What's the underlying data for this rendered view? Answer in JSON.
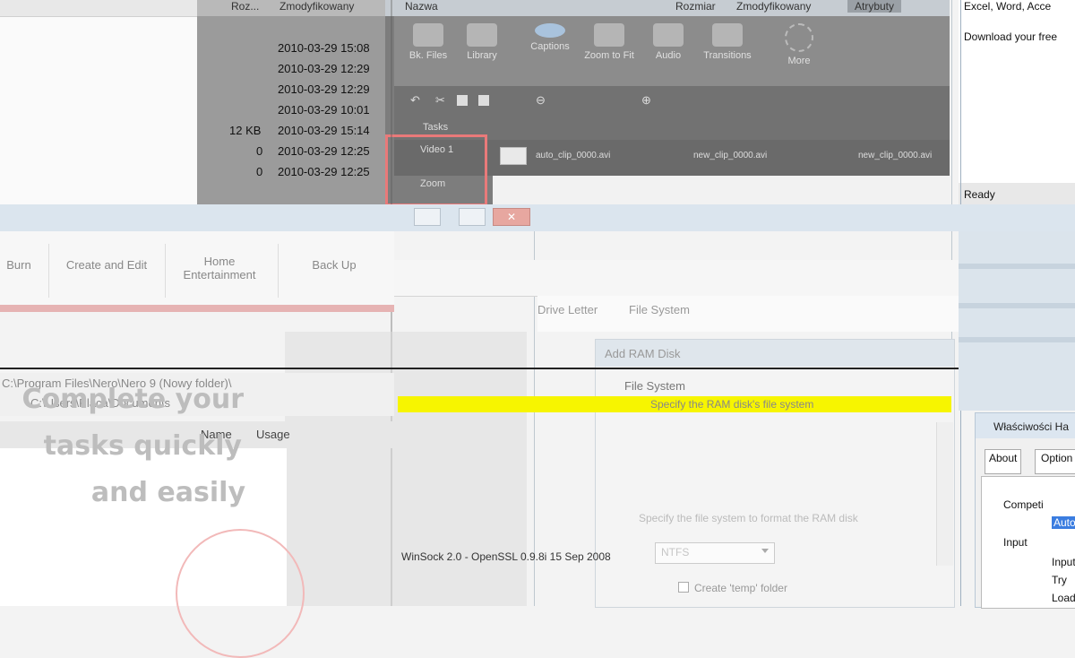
{
  "file_panel": {
    "headers": [
      "Roz...",
      "Zmodyfikowany"
    ],
    "rows": [
      {
        "size": "",
        "date": "2010-03-29 15:08"
      },
      {
        "size": "",
        "date": "2010-03-29 12:29"
      },
      {
        "size": "",
        "date": "2010-03-29 12:29"
      },
      {
        "size": "",
        "date": "2010-03-29 10:01"
      },
      {
        "size": "12 KB",
        "date": "2010-03-29 15:14"
      },
      {
        "size": "0",
        "date": "2010-03-29 12:25"
      },
      {
        "size": "0",
        "date": "2010-03-29 12:25"
      }
    ]
  },
  "editor": {
    "top_tabs": [
      "Nazwa",
      "Rozmiar",
      "Zmodyfikowany",
      "Atrybuty"
    ],
    "tools": [
      "Bk. Files",
      "Library",
      "Captions",
      "Zoom to Fit",
      "Audio",
      "Transitions",
      "More"
    ],
    "tasks_label": "Tasks",
    "video_label": "Video 1",
    "zoom_label": "Zoom",
    "clips": [
      "auto_clip_0000.avi",
      "new_clip_0000.avi",
      "new_clip_0000.avi"
    ]
  },
  "word_panel": {
    "line1": "Excel, Word, Acce",
    "line2": "Download your free",
    "status": "Ready"
  },
  "burn_tabs": [
    "Burn",
    "Create and Edit",
    "Home Entertainment",
    "Back Up"
  ],
  "ram_columns": [
    "Drive Letter",
    "File System"
  ],
  "path_rows": [
    "C:\\Program Files\\Nero\\Nero 9 (Nowy folder)\\",
    "C:\\Users\\Placa\\Documents"
  ],
  "usage_labels": [
    "Name",
    "Usage"
  ],
  "promo": {
    "line1": "Complete your",
    "line2": "tasks quickly",
    "line3": "and easily"
  },
  "add_ram": {
    "title": "Add RAM Disk",
    "fs_label": "File System",
    "yellow_text": "Specify the RAM disk's file system",
    "spec_text": "Specify the file system to format the RAM disk",
    "select_value": "NTFS",
    "checkbox_label": "Create 'temp' folder"
  },
  "winsock": "WinSock 2.0 - OpenSSL 0.9.8i 15 Sep 2008",
  "props": {
    "title": "Właściwości Ha",
    "tabs": [
      "About",
      "Option"
    ],
    "tree": [
      "Competi",
      "Auto",
      "Input",
      "Input",
      "Try",
      "Load"
    ]
  },
  "colors": {
    "highlight": "#f7f500",
    "accent_red": "#e97a7a",
    "selection": "#3b7de0"
  }
}
